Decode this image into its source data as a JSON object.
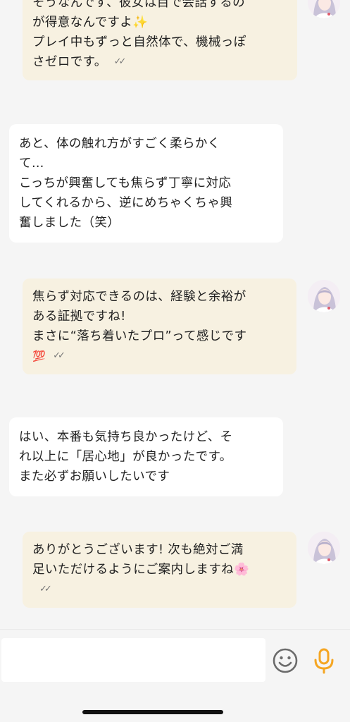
{
  "messages": [
    {
      "from": "shop",
      "lines": [
        "そうなんです、彼女は目で会話するの",
        "が得意なんですよ✨",
        "プレイ中もずっと自然体で、機械っぽ",
        "さゼロです。"
      ],
      "read": true
    },
    {
      "from": "user",
      "lines": [
        "あと、体の触れ方がすごく柔らかく",
        "て…",
        "こっちが興奮しても焦らず丁寧に対応",
        "してくれるから、逆にめちゃくちゃ興",
        "奮しました（笑）"
      ]
    },
    {
      "from": "shop",
      "lines": [
        "焦らず対応できるのは、経験と余裕が",
        "ある証拠ですね!",
        "まさに“落ち着いたプロ”って感じです",
        "💯"
      ],
      "read": true
    },
    {
      "from": "user",
      "lines": [
        "はい、本番も気持ち良かったけど、そ",
        "れ以上に「居心地」が良かったです。",
        "また必ずお願いしたいです"
      ]
    },
    {
      "from": "shop",
      "lines": [
        "ありがとうございます! 次も絶対ご満",
        "足いただけるようにご案内しますね🌸",
        ""
      ],
      "read": true
    }
  ],
  "read_mark": "✓✓",
  "composer": {
    "placeholder": "",
    "emoji_icon": "smiley-icon",
    "mic_icon": "microphone-icon",
    "mic_color": "#f5a623"
  }
}
